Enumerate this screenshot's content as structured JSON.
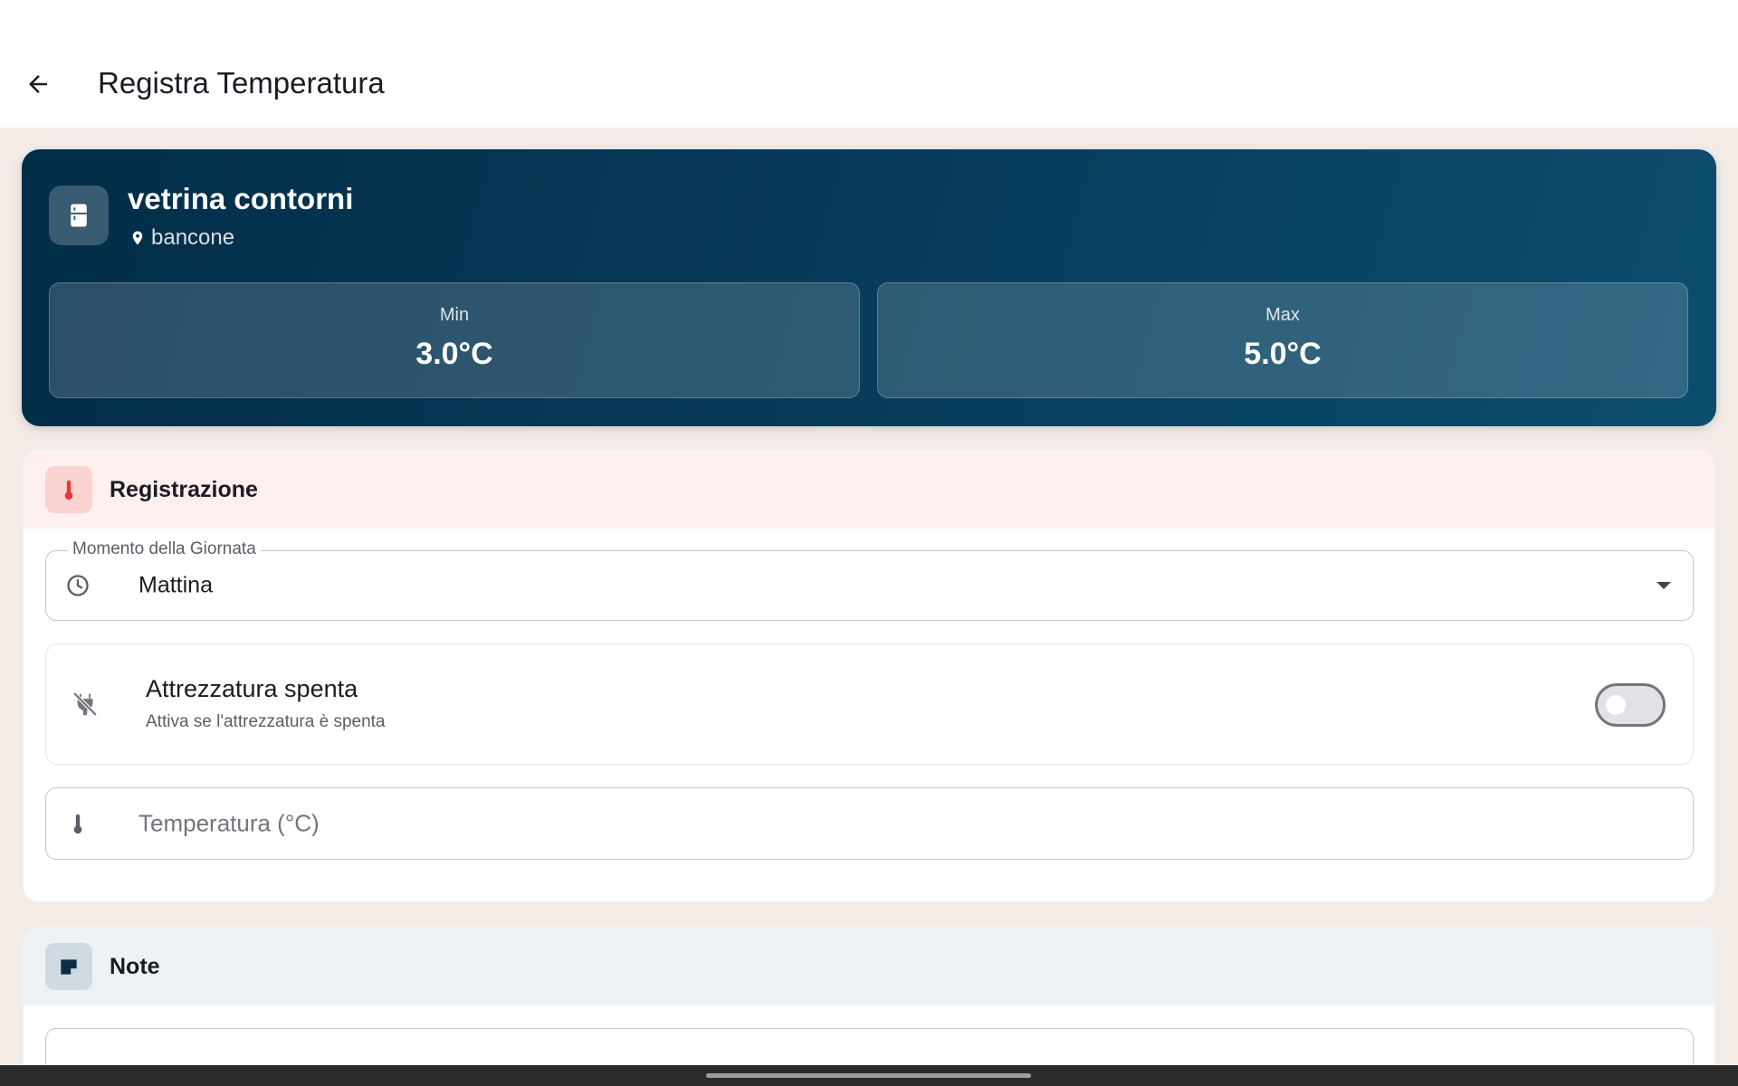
{
  "header": {
    "title": "Registra Temperatura",
    "back_icon": "arrow-left-icon"
  },
  "equipment": {
    "name": "vetrina contorni",
    "location": "bancone",
    "icon": "fridge-icon",
    "min_label": "Min",
    "min_value": "3.0°C",
    "max_label": "Max",
    "max_value": "5.0°C"
  },
  "registration": {
    "title": "Registrazione",
    "icon": "thermometer-icon",
    "moment_field": {
      "label": "Momento della Giornata",
      "value": "Mattina",
      "icon": "clock-icon"
    },
    "equipment_off": {
      "title": "Attrezzatura spenta",
      "subtitle": "Attiva se l'attrezzatura è spenta",
      "icon": "power-off-icon",
      "enabled": false
    },
    "temperature_field": {
      "placeholder": "Temperatura (°C)",
      "value": "",
      "icon": "thermometer-icon"
    }
  },
  "notes": {
    "title": "Note",
    "icon": "note-icon"
  },
  "colors": {
    "card_gradient_start": "#022d48",
    "card_gradient_end": "#0c4d6e",
    "registration_header_bg": "#fdf0ef",
    "thermometer_red": "#e53935",
    "notes_header_bg": "#eef2f5",
    "page_bg": "#f3ebe6"
  }
}
